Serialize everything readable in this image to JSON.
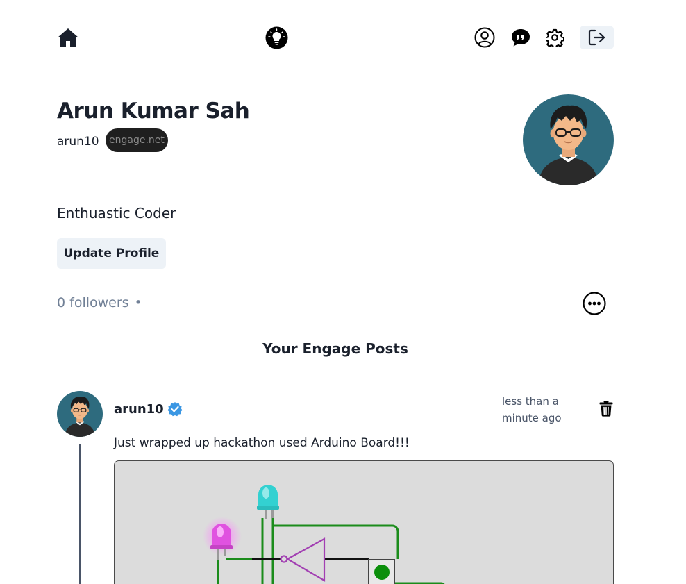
{
  "profile": {
    "name": "Arun Kumar Sah",
    "username": "arun10",
    "domain_badge": "engage.net",
    "bio": "Enthuastic Coder",
    "update_button": "Update Profile",
    "followers_text": "0 followers",
    "separator": "•"
  },
  "nav": {
    "icons": [
      "home-icon",
      "lightbulb-logo-icon",
      "user-circle-icon",
      "chat-icon",
      "gear-icon",
      "logout-icon"
    ]
  },
  "posts_section": {
    "title": "Your Engage Posts"
  },
  "post": {
    "username": "arun10",
    "time": "less than a minute ago",
    "text": "Just wrapped up hackathon used Arduino Board!!!"
  },
  "colors": {
    "text": "#1a202c",
    "muted": "#718096",
    "button_bg": "#edf2f7",
    "avatar_bg": "#2e6b7e",
    "verified": "#3b97e3",
    "badge_bg": "#1f1f1f"
  }
}
